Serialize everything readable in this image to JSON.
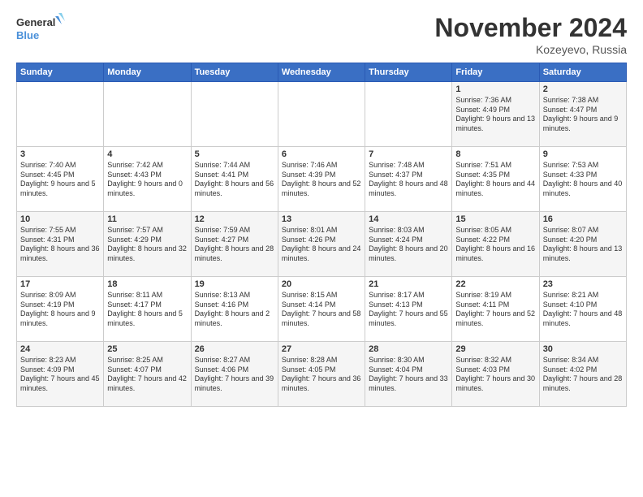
{
  "logo": {
    "line1": "General",
    "line2": "Blue"
  },
  "title": "November 2024",
  "location": "Kozeyevo, Russia",
  "days_of_week": [
    "Sunday",
    "Monday",
    "Tuesday",
    "Wednesday",
    "Thursday",
    "Friday",
    "Saturday"
  ],
  "weeks": [
    [
      {
        "day": "",
        "info": ""
      },
      {
        "day": "",
        "info": ""
      },
      {
        "day": "",
        "info": ""
      },
      {
        "day": "",
        "info": ""
      },
      {
        "day": "",
        "info": ""
      },
      {
        "day": "1",
        "info": "Sunrise: 7:36 AM\nSunset: 4:49 PM\nDaylight: 9 hours and 13 minutes."
      },
      {
        "day": "2",
        "info": "Sunrise: 7:38 AM\nSunset: 4:47 PM\nDaylight: 9 hours and 9 minutes."
      }
    ],
    [
      {
        "day": "3",
        "info": "Sunrise: 7:40 AM\nSunset: 4:45 PM\nDaylight: 9 hours and 5 minutes."
      },
      {
        "day": "4",
        "info": "Sunrise: 7:42 AM\nSunset: 4:43 PM\nDaylight: 9 hours and 0 minutes."
      },
      {
        "day": "5",
        "info": "Sunrise: 7:44 AM\nSunset: 4:41 PM\nDaylight: 8 hours and 56 minutes."
      },
      {
        "day": "6",
        "info": "Sunrise: 7:46 AM\nSunset: 4:39 PM\nDaylight: 8 hours and 52 minutes."
      },
      {
        "day": "7",
        "info": "Sunrise: 7:48 AM\nSunset: 4:37 PM\nDaylight: 8 hours and 48 minutes."
      },
      {
        "day": "8",
        "info": "Sunrise: 7:51 AM\nSunset: 4:35 PM\nDaylight: 8 hours and 44 minutes."
      },
      {
        "day": "9",
        "info": "Sunrise: 7:53 AM\nSunset: 4:33 PM\nDaylight: 8 hours and 40 minutes."
      }
    ],
    [
      {
        "day": "10",
        "info": "Sunrise: 7:55 AM\nSunset: 4:31 PM\nDaylight: 8 hours and 36 minutes."
      },
      {
        "day": "11",
        "info": "Sunrise: 7:57 AM\nSunset: 4:29 PM\nDaylight: 8 hours and 32 minutes."
      },
      {
        "day": "12",
        "info": "Sunrise: 7:59 AM\nSunset: 4:27 PM\nDaylight: 8 hours and 28 minutes."
      },
      {
        "day": "13",
        "info": "Sunrise: 8:01 AM\nSunset: 4:26 PM\nDaylight: 8 hours and 24 minutes."
      },
      {
        "day": "14",
        "info": "Sunrise: 8:03 AM\nSunset: 4:24 PM\nDaylight: 8 hours and 20 minutes."
      },
      {
        "day": "15",
        "info": "Sunrise: 8:05 AM\nSunset: 4:22 PM\nDaylight: 8 hours and 16 minutes."
      },
      {
        "day": "16",
        "info": "Sunrise: 8:07 AM\nSunset: 4:20 PM\nDaylight: 8 hours and 13 minutes."
      }
    ],
    [
      {
        "day": "17",
        "info": "Sunrise: 8:09 AM\nSunset: 4:19 PM\nDaylight: 8 hours and 9 minutes."
      },
      {
        "day": "18",
        "info": "Sunrise: 8:11 AM\nSunset: 4:17 PM\nDaylight: 8 hours and 5 minutes."
      },
      {
        "day": "19",
        "info": "Sunrise: 8:13 AM\nSunset: 4:16 PM\nDaylight: 8 hours and 2 minutes."
      },
      {
        "day": "20",
        "info": "Sunrise: 8:15 AM\nSunset: 4:14 PM\nDaylight: 7 hours and 58 minutes."
      },
      {
        "day": "21",
        "info": "Sunrise: 8:17 AM\nSunset: 4:13 PM\nDaylight: 7 hours and 55 minutes."
      },
      {
        "day": "22",
        "info": "Sunrise: 8:19 AM\nSunset: 4:11 PM\nDaylight: 7 hours and 52 minutes."
      },
      {
        "day": "23",
        "info": "Sunrise: 8:21 AM\nSunset: 4:10 PM\nDaylight: 7 hours and 48 minutes."
      }
    ],
    [
      {
        "day": "24",
        "info": "Sunrise: 8:23 AM\nSunset: 4:09 PM\nDaylight: 7 hours and 45 minutes."
      },
      {
        "day": "25",
        "info": "Sunrise: 8:25 AM\nSunset: 4:07 PM\nDaylight: 7 hours and 42 minutes."
      },
      {
        "day": "26",
        "info": "Sunrise: 8:27 AM\nSunset: 4:06 PM\nDaylight: 7 hours and 39 minutes."
      },
      {
        "day": "27",
        "info": "Sunrise: 8:28 AM\nSunset: 4:05 PM\nDaylight: 7 hours and 36 minutes."
      },
      {
        "day": "28",
        "info": "Sunrise: 8:30 AM\nSunset: 4:04 PM\nDaylight: 7 hours and 33 minutes."
      },
      {
        "day": "29",
        "info": "Sunrise: 8:32 AM\nSunset: 4:03 PM\nDaylight: 7 hours and 30 minutes."
      },
      {
        "day": "30",
        "info": "Sunrise: 8:34 AM\nSunset: 4:02 PM\nDaylight: 7 hours and 28 minutes."
      }
    ]
  ]
}
